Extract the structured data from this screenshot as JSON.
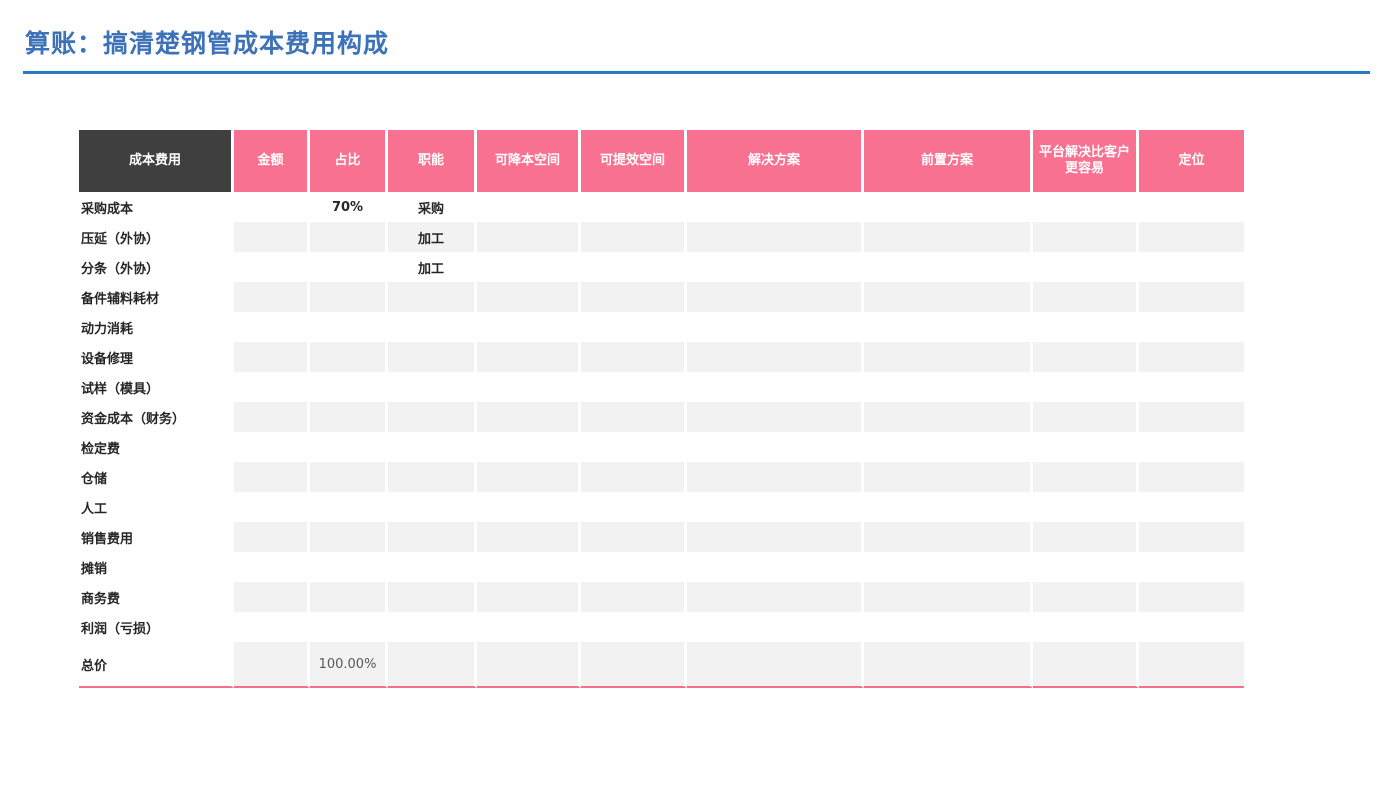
{
  "title": "算账：搞清楚钢管成本费用构成",
  "table": {
    "headers": [
      "成本费用",
      "金额",
      "占比",
      "职能",
      "可降本空间",
      "可提效空间",
      "解决方案",
      "前置方案",
      "平台解决比客户更容易",
      "定位"
    ],
    "rows": [
      [
        "采购成本",
        "",
        "70%",
        "采购",
        "",
        "",
        "",
        "",
        "",
        ""
      ],
      [
        "压延（外协）",
        "",
        "",
        "加工",
        "",
        "",
        "",
        "",
        "",
        ""
      ],
      [
        "分条（外协）",
        "",
        "",
        "加工",
        "",
        "",
        "",
        "",
        "",
        ""
      ],
      [
        "备件辅料耗材",
        "",
        "",
        "",
        "",
        "",
        "",
        "",
        "",
        ""
      ],
      [
        "动力消耗",
        "",
        "",
        "",
        "",
        "",
        "",
        "",
        "",
        ""
      ],
      [
        "设备修理",
        "",
        "",
        "",
        "",
        "",
        "",
        "",
        "",
        ""
      ],
      [
        "试样（模具）",
        "",
        "",
        "",
        "",
        "",
        "",
        "",
        "",
        ""
      ],
      [
        "资金成本（财务）",
        "",
        "",
        "",
        "",
        "",
        "",
        "",
        "",
        ""
      ],
      [
        "检定费",
        "",
        "",
        "",
        "",
        "",
        "",
        "",
        "",
        ""
      ],
      [
        "仓储",
        "",
        "",
        "",
        "",
        "",
        "",
        "",
        "",
        ""
      ],
      [
        "人工",
        "",
        "",
        "",
        "",
        "",
        "",
        "",
        "",
        ""
      ],
      [
        "销售费用",
        "",
        "",
        "",
        "",
        "",
        "",
        "",
        "",
        ""
      ],
      [
        "摊销",
        "",
        "",
        "",
        "",
        "",
        "",
        "",
        "",
        ""
      ],
      [
        "商务费",
        "",
        "",
        "",
        "",
        "",
        "",
        "",
        "",
        ""
      ],
      [
        "利润（亏损）",
        "",
        "",
        "",
        "",
        "",
        "",
        "",
        "",
        ""
      ]
    ],
    "total": [
      "总价",
      "",
      "100.00%",
      "",
      "",
      "",
      "",
      "",
      "",
      ""
    ]
  },
  "colors": {
    "title": "#3d72b8",
    "rule": "#2a78bf",
    "header_accent": "#f87190",
    "header_dark": "#3f3f3f",
    "row_alt": "#f2f2f2"
  }
}
